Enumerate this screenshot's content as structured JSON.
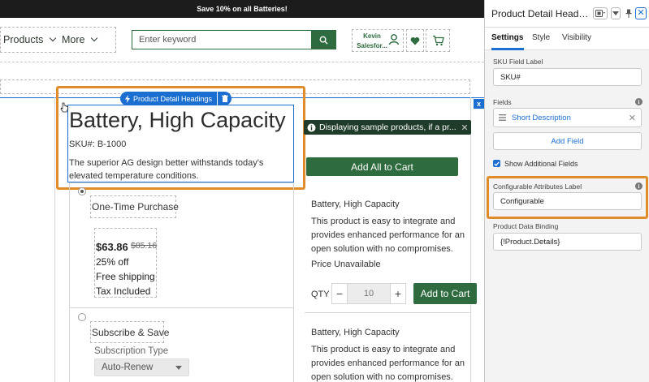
{
  "promo": {
    "text": "Save 10% on all Batteries!"
  },
  "nav": {
    "products_label": "Products",
    "more_label": "More",
    "search_placeholder": "Enter keyword",
    "user_first": "Kevin",
    "user_org": "Salesfor..."
  },
  "component": {
    "pill_label": "Product Detail Headings",
    "title": "Battery, High Capacity",
    "sku": "SKU#: B-1000",
    "description": "The superior AG design better withstands today's elevated temperature conditions."
  },
  "toast": {
    "message": "Displaying sample products, if a pr..."
  },
  "add_all_label": "Add All to Cart",
  "purchase_options": {
    "one_time_label": "One-Time Purchase",
    "price": "$63.86",
    "old_price": "$85.16",
    "discount": "25% off",
    "shipping": "Free shipping",
    "tax": "Tax Included",
    "subscribe_label": "Subscribe & Save",
    "subscription_type_label": "Subscription Type",
    "subscription_value": "Auto-Renew"
  },
  "products": [
    {
      "name": "Battery, High Capacity",
      "description": "This product is easy to integrate and provides enhanced performance for an open solution with no compromises.",
      "price_status": "Price Unavailable"
    },
    {
      "name": "Battery, High Capacity",
      "description": "This product is easy to integrate and provides enhanced performance for an open solution with no compromises."
    }
  ],
  "qty": {
    "label": "QTY",
    "value": "10",
    "add_to_cart": "Add to Cart"
  },
  "panel": {
    "title": "Product Detail Headings",
    "tabs": [
      "Settings",
      "Style",
      "Visibility"
    ],
    "sku_label": "SKU Field Label",
    "sku_value": "SKU#",
    "fields_label": "Fields",
    "field_item": "Short Description",
    "add_field": "Add Field",
    "show_additional": "Show Additional Fields",
    "configurable_label": "Configurable Attributes Label",
    "configurable_value": "Configurable",
    "binding_label": "Product Data Binding",
    "binding_value": "{!Product.Details}"
  },
  "colors": {
    "brand_green": "#2e6b3e",
    "accent_blue": "#1b6fd1",
    "highlight_orange": "#e08c2a"
  }
}
